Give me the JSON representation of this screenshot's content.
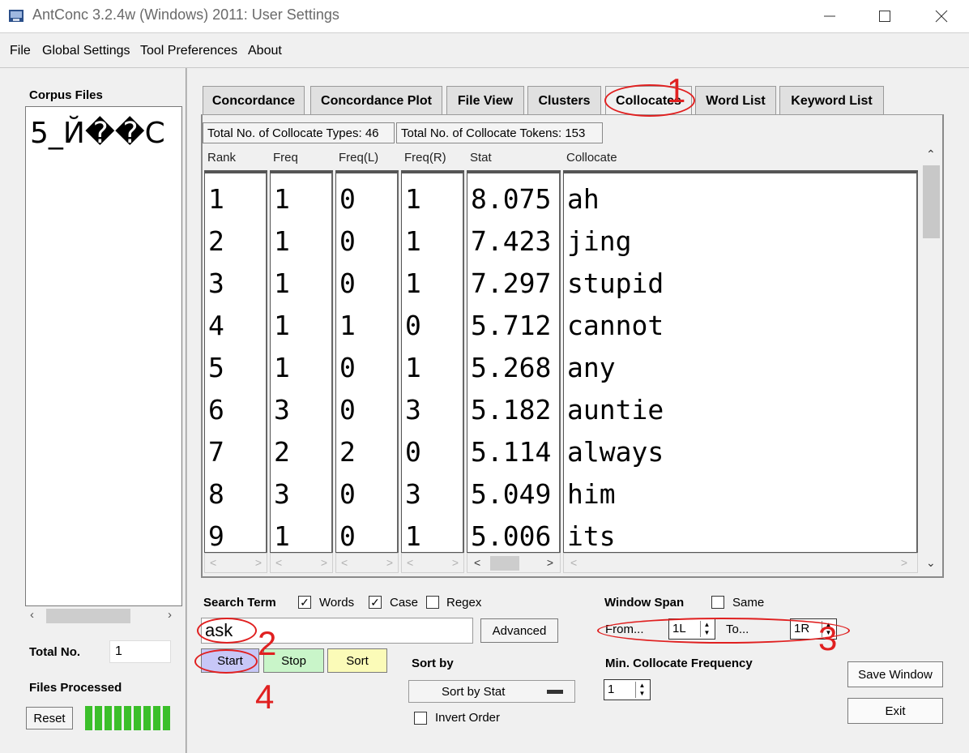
{
  "window": {
    "title": "AntConc 3.2.4w (Windows) 2011: User Settings"
  },
  "menu": [
    "File",
    "Global Settings",
    "Tool Preferences",
    "About"
  ],
  "corpus": {
    "title": "Corpus Files",
    "files": [
      "5_Й��C"
    ],
    "total_label": "Total No.",
    "total_value": "1",
    "files_processed_label": "Files Processed",
    "reset_label": "Reset"
  },
  "tabs": [
    "Concordance",
    "Concordance Plot",
    "File View",
    "Clusters",
    "Collocates",
    "Word List",
    "Keyword List"
  ],
  "active_tab": "Collocates",
  "status": {
    "types": "Total No. of Collocate Types: 46",
    "tokens": "Total No. of Collocate Tokens: 153"
  },
  "table": {
    "headers": [
      "Rank",
      "Freq",
      "Freq(L)",
      "Freq(R)",
      "Stat",
      "Collocate"
    ],
    "rows": [
      [
        "1",
        "1",
        "0",
        "1",
        "8.075",
        "ah"
      ],
      [
        "2",
        "1",
        "0",
        "1",
        "7.423",
        "jing"
      ],
      [
        "3",
        "1",
        "0",
        "1",
        "7.297",
        "stupid"
      ],
      [
        "4",
        "1",
        "1",
        "0",
        "5.712",
        "cannot"
      ],
      [
        "5",
        "1",
        "0",
        "1",
        "5.268",
        "any"
      ],
      [
        "6",
        "3",
        "0",
        "3",
        "5.182",
        "auntie"
      ],
      [
        "7",
        "2",
        "2",
        "0",
        "5.114",
        "always"
      ],
      [
        "8",
        "3",
        "0",
        "3",
        "5.049",
        "him"
      ],
      [
        "9",
        "1",
        "0",
        "1",
        "5.006",
        "its"
      ]
    ]
  },
  "search": {
    "label": "Search Term",
    "words_label": "Words",
    "words_checked": true,
    "case_label": "Case",
    "case_checked": true,
    "regex_label": "Regex",
    "regex_checked": false,
    "term": "ask",
    "advanced_label": "Advanced",
    "start_label": "Start",
    "stop_label": "Stop",
    "sort_label": "Sort",
    "sort_by_label": "Sort by",
    "sort_by_value": "Sort by Stat",
    "invert_label": "Invert Order"
  },
  "window_span": {
    "label": "Window Span",
    "same_label": "Same",
    "from_label": "From...",
    "from_value": "1L",
    "to_label": "To...",
    "to_value": "1R",
    "min_freq_label": "Min. Collocate Frequency",
    "min_freq_value": "1"
  },
  "buttons": {
    "save_window": "Save Window",
    "exit": "Exit"
  },
  "annotations": [
    "1",
    "2",
    "3",
    "4"
  ],
  "colors": {
    "annotation": "#e02020",
    "start_button": "#c7c7f7",
    "stop_button": "#c9f5c9",
    "sort_button": "#fbfbb8",
    "progress": "#3bbf2a"
  }
}
